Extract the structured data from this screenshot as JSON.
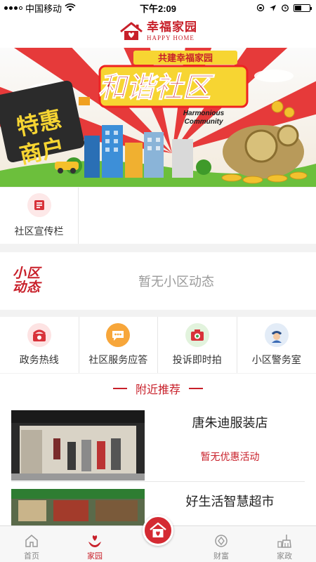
{
  "status_bar": {
    "carrier": "中国移动",
    "time": "下午2:09"
  },
  "header": {
    "title_cn": "幸福家园",
    "title_en": "HAPPY HOME"
  },
  "banner": {
    "badge": "共建幸福家园",
    "headline": "和谐社区",
    "headline_en_1": "Harmonious",
    "headline_en_2": "Community",
    "side_text_1": "特惠",
    "side_text_2": "商户"
  },
  "board": {
    "items": [
      {
        "label": "社区宣传栏",
        "icon": "bulletin-board-icon"
      }
    ]
  },
  "news": {
    "logo_line1": "小区",
    "logo_line2": "动态",
    "empty_text": "暂无小区动态"
  },
  "services": {
    "items": [
      {
        "label": "政务热线",
        "icon": "phone-icon"
      },
      {
        "label": "社区服务应答",
        "icon": "chat-bubble-icon"
      },
      {
        "label": "投诉即时拍",
        "icon": "camera-icon"
      },
      {
        "label": "小区警务室",
        "icon": "police-icon"
      }
    ]
  },
  "nearby": {
    "title": "附近推荐",
    "shops": [
      {
        "name": "唐朱迪服装店",
        "promo": "暂无优惠活动"
      },
      {
        "name": "好生活智慧超市",
        "promo": ""
      }
    ]
  },
  "tab_bar": {
    "items": [
      {
        "label": "首页",
        "icon": "home-icon"
      },
      {
        "label": "家园",
        "icon": "hands-heart-icon"
      },
      {
        "label": "",
        "icon": "house-heart-icon"
      },
      {
        "label": "财富",
        "icon": "diamond-icon"
      },
      {
        "label": "家政",
        "icon": "broom-icon"
      }
    ],
    "active": "家园"
  },
  "colors": {
    "brand_red": "#c8202a",
    "background": "#f2f2f2"
  }
}
